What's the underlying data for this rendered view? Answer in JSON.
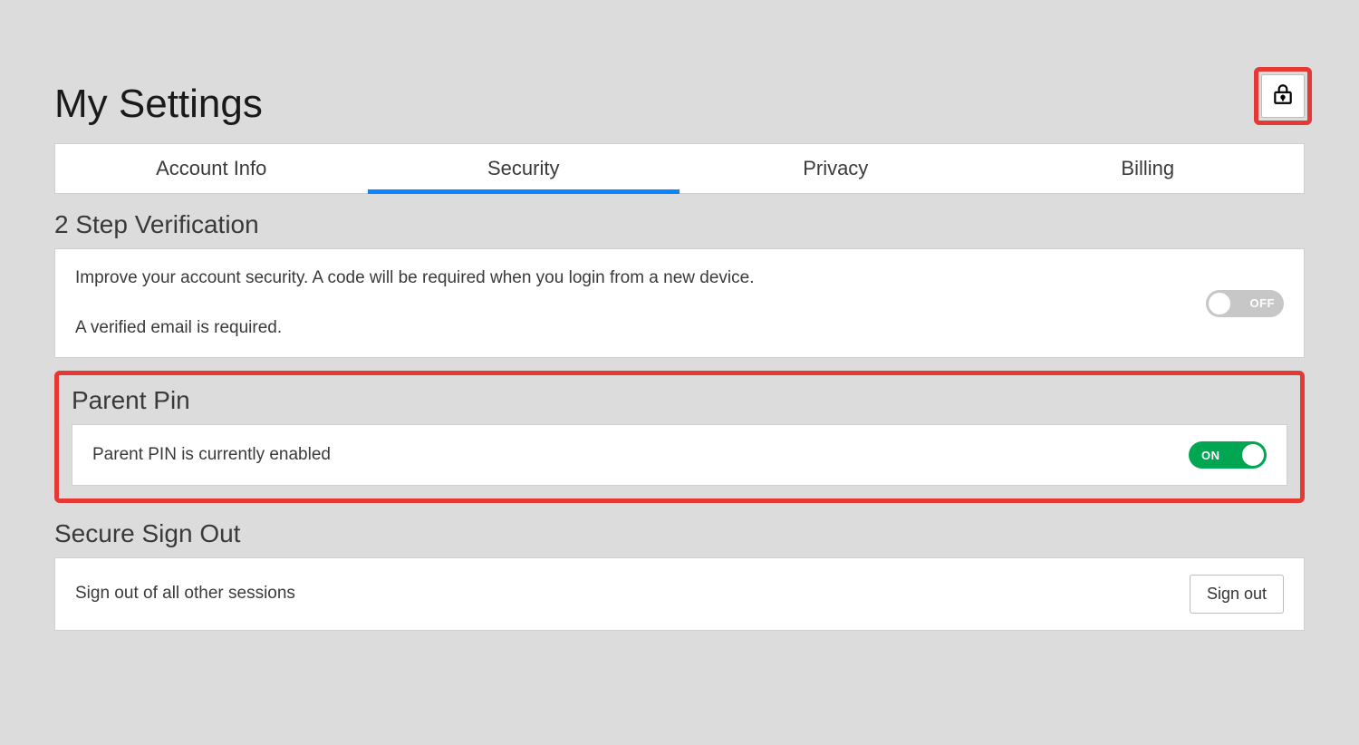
{
  "page_title": "My Settings",
  "tabs": {
    "account_info": "Account Info",
    "security": "Security",
    "privacy": "Privacy",
    "billing": "Billing",
    "active": "security"
  },
  "sections": {
    "two_step": {
      "title": "2 Step Verification",
      "desc": "Improve your account security. A code will be required when you login from a new device.",
      "note": "A verified email is required.",
      "toggle_label": "OFF",
      "toggle_state": "off"
    },
    "parent_pin": {
      "title": "Parent Pin",
      "desc": "Parent PIN is currently enabled",
      "toggle_label": "ON",
      "toggle_state": "on"
    },
    "secure_signout": {
      "title": "Secure Sign Out",
      "desc": "Sign out of all other sessions",
      "button": "Sign out"
    }
  }
}
